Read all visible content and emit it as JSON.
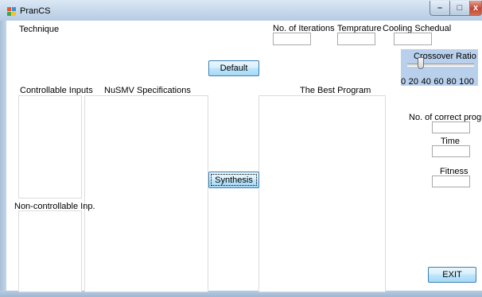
{
  "window": {
    "title": "PranCS",
    "minimize": "–",
    "maximize": "□",
    "close": "x"
  },
  "labels": {
    "technique": "Technique",
    "iterations": "No. of Iterations",
    "temperature": "Temprature",
    "cooling": "Cooling Schedual",
    "crossover": "Crossover Ratio",
    "controllable": "Controllable Inputs",
    "nusmv": "NuSMV Specifications",
    "best_program": "The Best Program",
    "non_controllable": "Non-controllable Inp.",
    "correct_programs": "No. of correct programs",
    "time": "Time",
    "fitness": "Fitness"
  },
  "inputs": {
    "iterations": "",
    "temperature": "",
    "cooling": "",
    "correct_programs": "",
    "time": "",
    "fitness": ""
  },
  "slider": {
    "scale": "0  20  40  60  80  100",
    "value": 20
  },
  "buttons": {
    "default": "Default",
    "synthesis": "Synthesis",
    "exit": "EXIT"
  },
  "colors": {
    "window_frame": "#b9d1ea",
    "button_border": "#3c7fb1",
    "close_red": "#c4452f"
  }
}
